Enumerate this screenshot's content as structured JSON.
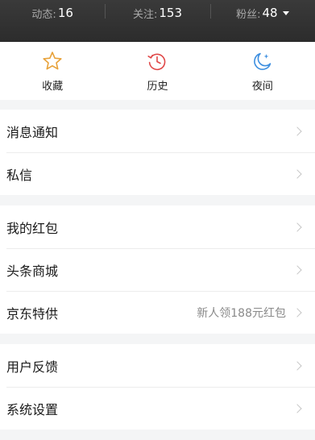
{
  "stats": [
    {
      "label": "动态:",
      "value": "16"
    },
    {
      "label": "关注:",
      "value": "153"
    },
    {
      "label": "粉丝:",
      "value": "48"
    }
  ],
  "quick": [
    {
      "label": "收藏",
      "icon": "star-icon",
      "color": "#e8a23a"
    },
    {
      "label": "历史",
      "icon": "history-icon",
      "color": "#e04848"
    },
    {
      "label": "夜间",
      "icon": "night-mode-icon",
      "color": "#3d8fe0"
    }
  ],
  "groups": [
    {
      "items": [
        {
          "label": "消息通知"
        },
        {
          "label": "私信"
        }
      ]
    },
    {
      "items": [
        {
          "label": "我的红包"
        },
        {
          "label": "头条商城"
        },
        {
          "label": "京东特供",
          "extra": "新人领188元红包"
        }
      ]
    },
    {
      "items": [
        {
          "label": "用户反馈"
        },
        {
          "label": "系统设置"
        }
      ]
    }
  ]
}
